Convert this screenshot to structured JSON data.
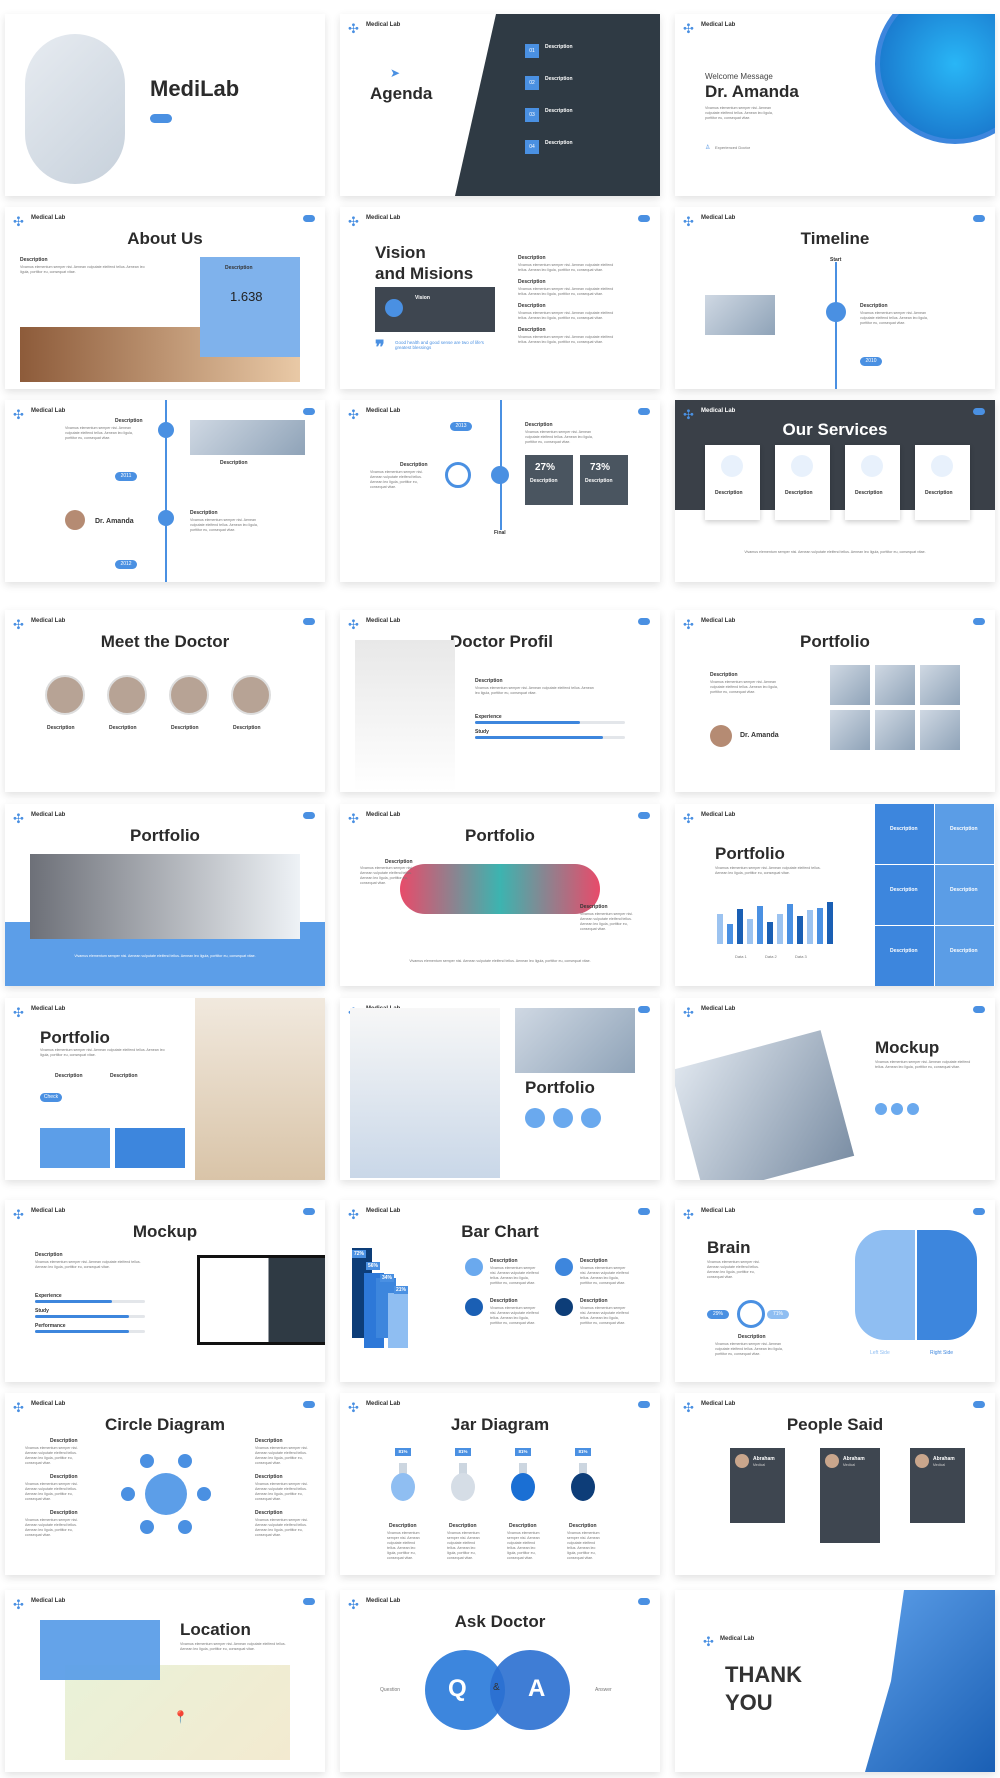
{
  "brand": "Medical Lab",
  "lorem": "Vivamus elementum semper nisi. Aenean vulputate eleifend tellus. Aenean leo ligula, porttitor eu, consequat vitae.",
  "colors": {
    "accent": "#4a90e2",
    "dark": "#3a4048"
  },
  "slides": [
    {
      "kind": "cover",
      "title": "MediLab"
    },
    {
      "kind": "agenda",
      "title": "Agenda",
      "items": [
        "01",
        "02",
        "03",
        "04"
      ],
      "item_label": "Description"
    },
    {
      "kind": "welcome",
      "subtitle": "Welcome Message",
      "title": "Dr. Amanda",
      "note": "Experienced Doctor"
    },
    {
      "kind": "about",
      "title": "About Us",
      "desc": "Description",
      "number": "1.638"
    },
    {
      "kind": "vision",
      "title": "Vision",
      "title2": "and Misions",
      "box": "Vision",
      "quote": "Good health and good sense are two of life's greatest blessings",
      "desc": "Description"
    },
    {
      "kind": "timeline",
      "title": "Timeline",
      "start": "Start",
      "desc": "Description",
      "year": "2010"
    },
    {
      "kind": "timeline2",
      "desc": "Description",
      "years": [
        "2011",
        "2012"
      ],
      "name": "Dr. Amanda"
    },
    {
      "kind": "timeline3",
      "year": "2013",
      "desc": "Description",
      "final": "Final",
      "stats": [
        "27%",
        "73%"
      ]
    },
    {
      "kind": "services",
      "title": "Our Services",
      "desc": "Description"
    },
    {
      "kind": "doctors",
      "title": "Meet the Doctor",
      "desc": "Description"
    },
    {
      "kind": "profil",
      "title": "Doctor Profil",
      "desc": "Description",
      "bars": [
        {
          "label": "Experience",
          "value": 70
        },
        {
          "label": "Study",
          "value": 85
        }
      ]
    },
    {
      "kind": "portfolio1",
      "title": "Portfolio",
      "desc": "Description",
      "name": "Dr. Amanda"
    },
    {
      "kind": "portfolio2",
      "title": "Portfolio"
    },
    {
      "kind": "portfolio3",
      "title": "Portfolio",
      "desc": "Description"
    },
    {
      "kind": "portfolio4",
      "title": "Portfolio",
      "desc": "Description",
      "legend": [
        "Data 1",
        "Data 2",
        "Data 3"
      ]
    },
    {
      "kind": "portfolio5",
      "title": "Portfolio",
      "desc": "Description",
      "button": "Check"
    },
    {
      "kind": "portfolio6",
      "title": "Portfolio"
    },
    {
      "kind": "mockup1",
      "title": "Mockup"
    },
    {
      "kind": "mockup2",
      "title": "Mockup",
      "desc": "Description",
      "bars": [
        {
          "label": "Experience",
          "value": 70
        },
        {
          "label": "Study",
          "value": 85
        },
        {
          "label": "Performance",
          "value": 85
        }
      ]
    },
    {
      "kind": "barchart",
      "title": "Bar Chart",
      "values": [
        "72%",
        "56%",
        "34%",
        "21%"
      ],
      "desc": "Description"
    },
    {
      "kind": "brain",
      "title": "Brain",
      "left": "29%",
      "right": "71%",
      "desc": "Description",
      "left_label": "Left Side",
      "right_label": "Right Side"
    },
    {
      "kind": "circle",
      "title": "Circle Diagram",
      "desc": "Description"
    },
    {
      "kind": "jar",
      "title": "Jar Diagram",
      "values": [
        "81%",
        "81%",
        "81%",
        "81%"
      ],
      "desc": "Description"
    },
    {
      "kind": "people",
      "title": "People Said",
      "name": "Abraham",
      "role": "Medical"
    },
    {
      "kind": "location",
      "title": "Location"
    },
    {
      "kind": "ask",
      "title": "Ask Doctor",
      "q": "Q",
      "amp": "&",
      "ans": "A",
      "question": "Question",
      "answer": "Answer"
    },
    {
      "kind": "thanks",
      "title": "THANK",
      "title2": "YOU"
    }
  ]
}
